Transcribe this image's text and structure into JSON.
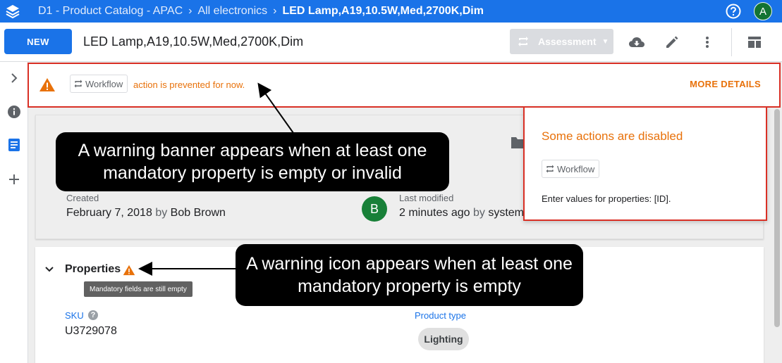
{
  "header": {
    "breadcrumbs": [
      "D1 - Product Catalog - APAC",
      "All electronics",
      "LED Lamp,A19,10.5W,Med,2700K,Dim"
    ],
    "avatar_initial": "A",
    "icons": [
      "stack-logo-icon",
      "help-icon"
    ]
  },
  "toolbar": {
    "new_label": "NEW",
    "doc_title": "LED Lamp,A19,10.5W,Med,2700K,Dim",
    "assessment_label": "Assessment",
    "icons": [
      "workflow-sync-icon",
      "cloud-download-icon",
      "edit-pencil-icon",
      "more-vert-icon",
      "layout-icon"
    ]
  },
  "rail": {
    "icons": [
      "chevron-right-icon",
      "info-icon",
      "document-icon",
      "add-icon"
    ]
  },
  "banner": {
    "chip_label": "Workflow",
    "message": "action is prevented for now.",
    "more_details": "MORE DETAILS",
    "accent": "#e8710a",
    "border": "#d93025"
  },
  "meta": {
    "created_label": "Created",
    "created_date": "February 7, 2018",
    "created_by_prefix": "by",
    "created_by": "Bob Brown",
    "modified_avatar": "B",
    "modified_label": "Last modified",
    "modified_time": "2 minutes ago",
    "modified_by_prefix": "by",
    "modified_by": "system"
  },
  "properties": {
    "title": "Properties",
    "tooltip": "Mandatory fields are still empty",
    "sku_label": "SKU",
    "sku_help": "?",
    "sku_value": "U3729078",
    "product_type_label": "Product type",
    "product_type_value": "Lighting"
  },
  "popover": {
    "title": "Some actions are disabled",
    "chip_label": "Workflow",
    "message": "Enter values for properties: [ID]."
  },
  "callouts": {
    "banner_note": "A warning banner appears when at least one mandatory property is empty or invalid",
    "icon_note": "A warning icon appears when at least one mandatory property is empty"
  }
}
